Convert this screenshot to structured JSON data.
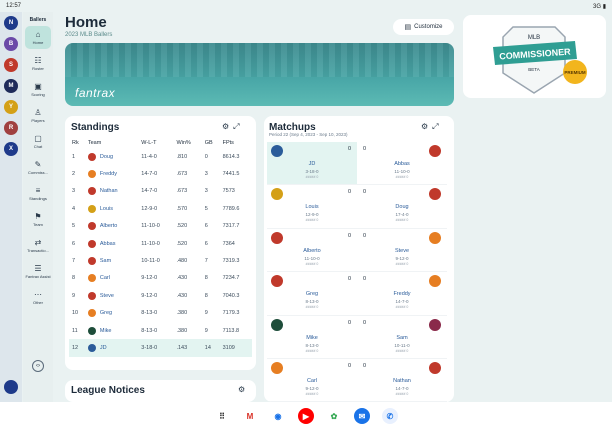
{
  "status": {
    "time": "12:57",
    "signal": "3G"
  },
  "leagues": [
    {
      "abbr": "N",
      "color": "#1e3a8a"
    },
    {
      "abbr": "B",
      "color": "#6b4aa8"
    },
    {
      "abbr": "S",
      "color": "#c0392b"
    },
    {
      "abbr": "M",
      "color": "#1e2a5a"
    },
    {
      "abbr": "Y",
      "color": "#d4a017"
    },
    {
      "abbr": "R",
      "color": "#a04040"
    },
    {
      "abbr": "X",
      "color": "#1e3a8a"
    }
  ],
  "nav": {
    "league_name": "Ballers",
    "items": [
      {
        "label": "Home",
        "icon": "⌂"
      },
      {
        "label": "Roster",
        "icon": "☷"
      },
      {
        "label": "Scoring",
        "icon": "▣"
      },
      {
        "label": "Players",
        "icon": "♙"
      },
      {
        "label": "Chat",
        "icon": "▢"
      },
      {
        "label": "Commiss...",
        "icon": "✎"
      },
      {
        "label": "Standings",
        "icon": "≡"
      },
      {
        "label": "Team",
        "icon": "⚑"
      },
      {
        "label": "Transactio...",
        "icon": "⇄"
      },
      {
        "label": "Fantrax Assist",
        "icon": "☰"
      },
      {
        "label": "Other",
        "icon": "⋯"
      }
    ],
    "collapse_icon": "‹›"
  },
  "header": {
    "title": "Home",
    "subtitle": "2023 MLB Ballers",
    "customize_label": "Customize"
  },
  "banner": {
    "logo": "fantrax"
  },
  "commissioner": {
    "top_text": "MLB",
    "ribbon_text": "COMMISSIONER",
    "sub_text": "BETA",
    "badge_text": "PREMIUM"
  },
  "standings": {
    "title": "Standings",
    "columns": [
      "Rk",
      "Team",
      "W-L-T",
      "Win%",
      "GB",
      "FPts"
    ],
    "rows": [
      {
        "rk": "1",
        "team": "Doug",
        "wlt": "11-4-0",
        "pct": ".810",
        "gb": "0",
        "fpts": "8614.3",
        "color": "#c0392b"
      },
      {
        "rk": "2",
        "team": "Freddy",
        "wlt": "14-7-0",
        "pct": ".673",
        "gb": "3",
        "fpts": "7441.5",
        "color": "#e67e22"
      },
      {
        "rk": "3",
        "team": "Nathan",
        "wlt": "14-7-0",
        "pct": ".673",
        "gb": "3",
        "fpts": "7573",
        "color": "#c0392b"
      },
      {
        "rk": "4",
        "team": "Louis",
        "wlt": "12-9-0",
        "pct": ".570",
        "gb": "5",
        "fpts": "7789.6",
        "color": "#d4a017"
      },
      {
        "rk": "5",
        "team": "Alberto",
        "wlt": "11-10-0",
        "pct": ".520",
        "gb": "6",
        "fpts": "7317.7",
        "color": "#c0392b"
      },
      {
        "rk": "6",
        "team": "Abbas",
        "wlt": "11-10-0",
        "pct": ".520",
        "gb": "6",
        "fpts": "7364",
        "color": "#c0392b"
      },
      {
        "rk": "7",
        "team": "Sam",
        "wlt": "10-11-0",
        "pct": ".480",
        "gb": "7",
        "fpts": "7319.3",
        "color": "#c0392b"
      },
      {
        "rk": "8",
        "team": "Carl",
        "wlt": "9-12-0",
        "pct": ".430",
        "gb": "8",
        "fpts": "7234.7",
        "color": "#e67e22"
      },
      {
        "rk": "9",
        "team": "Steve",
        "wlt": "9-12-0",
        "pct": ".430",
        "gb": "8",
        "fpts": "7040.3",
        "color": "#c0392b"
      },
      {
        "rk": "10",
        "team": "Greg",
        "wlt": "8-13-0",
        "pct": ".380",
        "gb": "9",
        "fpts": "7179.3",
        "color": "#e67e22"
      },
      {
        "rk": "11",
        "team": "Mike",
        "wlt": "8-13-0",
        "pct": ".380",
        "gb": "9",
        "fpts": "7113.8",
        "color": "#1e4d3a"
      },
      {
        "rk": "12",
        "team": "JD",
        "wlt": "3-18-0",
        "pct": ".143",
        "gb": "14",
        "fpts": "3109",
        "color": "#2b5c9a"
      }
    ]
  },
  "matchups": {
    "title": "Matchups",
    "period": "Period 22 (Sep 4, 2023 - Sep 10, 2023)",
    "rows": [
      {
        "left": {
          "name": "JD",
          "record": "3-18-0",
          "proj": "##### 0",
          "score": "0",
          "color": "#2b5c9a"
        },
        "right": {
          "name": "Abbas",
          "record": "11-10-0",
          "proj": "##### 0",
          "score": "0",
          "color": "#c0392b"
        },
        "winner": "left"
      },
      {
        "left": {
          "name": "Louis",
          "record": "12-9-0",
          "proj": "##### 0",
          "score": "0",
          "color": "#d4a017"
        },
        "right": {
          "name": "Doug",
          "record": "17-4-0",
          "proj": "##### 0",
          "score": "0",
          "color": "#c0392b"
        }
      },
      {
        "left": {
          "name": "Alberto",
          "record": "11-10-0",
          "proj": "##### 0",
          "score": "0",
          "color": "#c0392b"
        },
        "right": {
          "name": "Steve",
          "record": "9-12-0",
          "proj": "##### 0",
          "score": "0",
          "color": "#e67e22"
        }
      },
      {
        "left": {
          "name": "Greg",
          "record": "8-13-0",
          "proj": "##### 0",
          "score": "0",
          "color": "#c0392b"
        },
        "right": {
          "name": "Freddy",
          "record": "14-7-0",
          "proj": "##### 0",
          "score": "0",
          "color": "#e67e22"
        }
      },
      {
        "left": {
          "name": "Mike",
          "record": "8-13-0",
          "proj": "##### 0",
          "score": "0",
          "color": "#1e4d3a"
        },
        "right": {
          "name": "Sam",
          "record": "10-11-0",
          "proj": "##### 0",
          "score": "0",
          "color": "#8a2a4a"
        }
      },
      {
        "left": {
          "name": "Carl",
          "record": "9-12-0",
          "proj": "##### 0",
          "score": "0",
          "color": "#e67e22"
        },
        "right": {
          "name": "Nathan",
          "record": "14-7-0",
          "proj": "##### 0",
          "score": "0",
          "color": "#c0392b"
        }
      }
    ]
  },
  "notices": {
    "title": "League Notices"
  },
  "dock": [
    {
      "name": "apps-grid-icon",
      "glyph": "⠿",
      "bg": "#ffffff",
      "fg": "#333333"
    },
    {
      "name": "gmail-icon",
      "glyph": "M",
      "bg": "#ffffff",
      "fg": "#d93025"
    },
    {
      "name": "chrome-icon",
      "glyph": "◉",
      "bg": "#ffffff",
      "fg": "#1a73e8"
    },
    {
      "name": "youtube-icon",
      "glyph": "▶",
      "bg": "#ff0000",
      "fg": "#ffffff"
    },
    {
      "name": "photos-icon",
      "glyph": "✿",
      "bg": "#ffffff",
      "fg": "#34a853"
    },
    {
      "name": "messages-icon",
      "glyph": "✉",
      "bg": "#1a73e8",
      "fg": "#ffffff"
    },
    {
      "name": "phone-icon",
      "glyph": "✆",
      "bg": "#e8f0fe",
      "fg": "#1a73e8"
    }
  ]
}
